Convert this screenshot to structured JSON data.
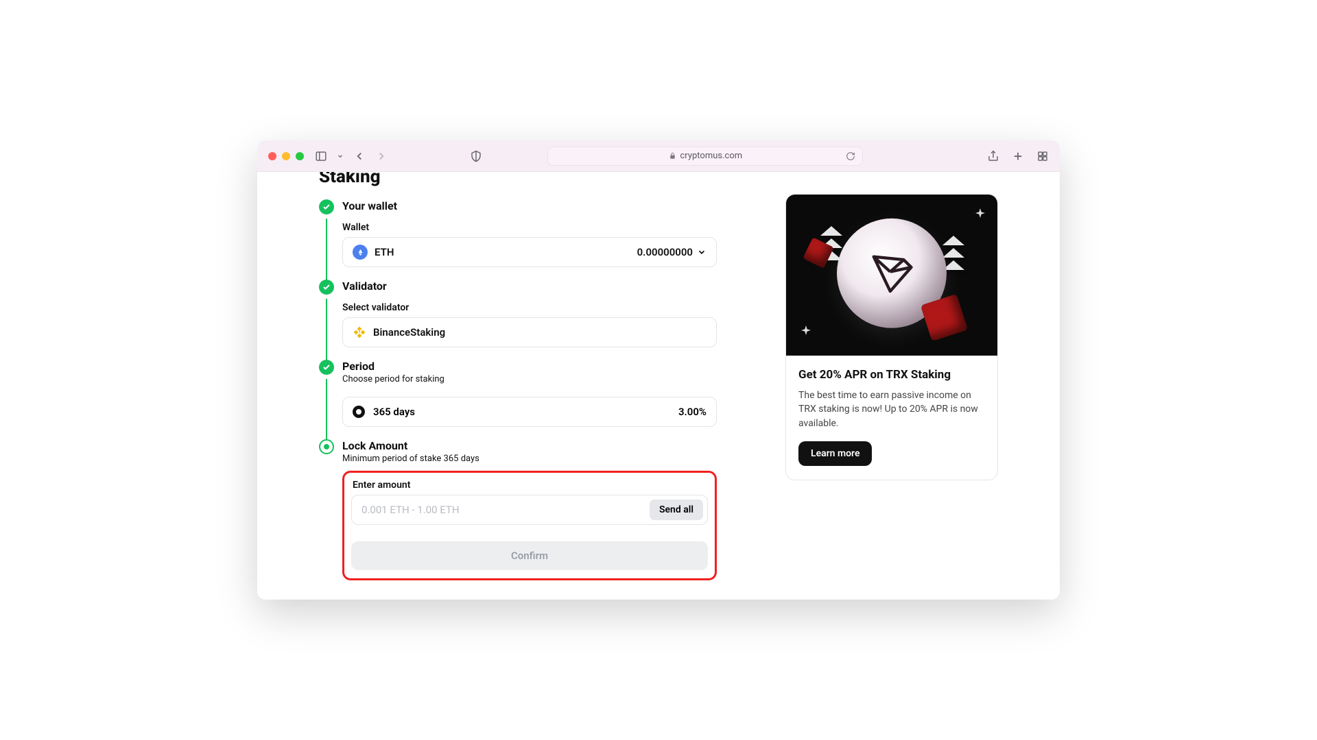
{
  "browser": {
    "url": "cryptomus.com"
  },
  "page": {
    "title": "Staking"
  },
  "steps": {
    "wallet": {
      "title": "Your wallet",
      "label": "Wallet",
      "currency": "ETH",
      "balance": "0.00000000"
    },
    "validator": {
      "title": "Validator",
      "label": "Select validator",
      "name": "BinanceStaking"
    },
    "period": {
      "title": "Period",
      "sub": "Choose period for staking",
      "option": "365 days",
      "rate": "3.00%"
    },
    "amount": {
      "title": "Lock Amount",
      "sub": "Minimum period of stake 365 days",
      "label": "Enter amount",
      "placeholder": "0.001 ETH - 1.00 ETH",
      "send_all": "Send all",
      "confirm": "Confirm"
    }
  },
  "promo": {
    "title": "Get 20% APR on TRX Staking",
    "desc": "The best time to earn passive income on TRX staking is now! Up to 20% APR is now available.",
    "cta": "Learn more"
  }
}
